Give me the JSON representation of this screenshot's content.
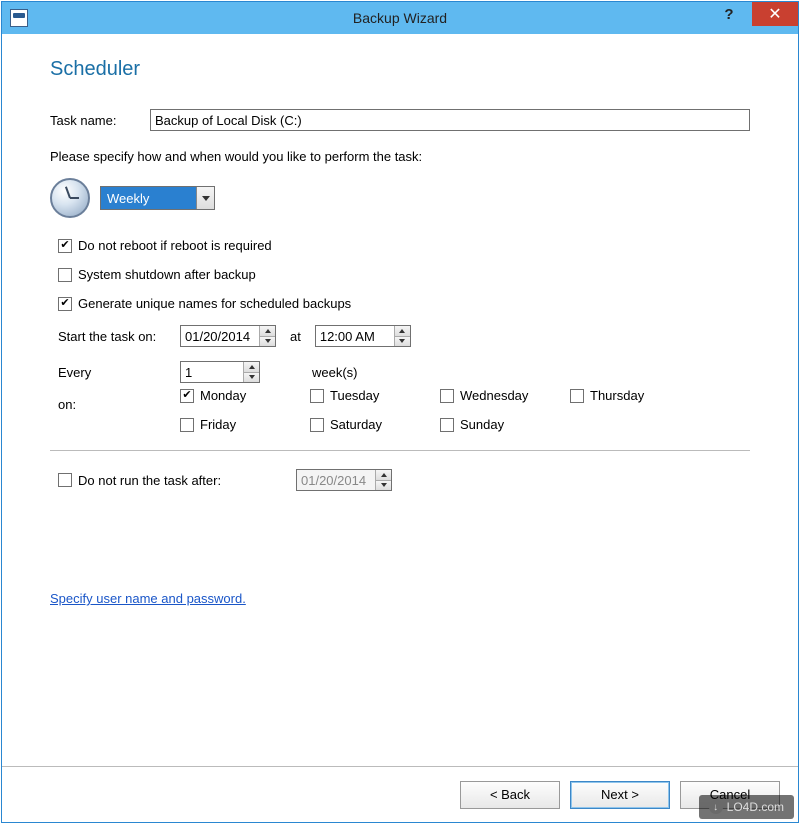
{
  "window": {
    "title": "Backup Wizard",
    "help_symbol": "?",
    "close_symbol": "✕"
  },
  "page": {
    "heading": "Scheduler",
    "task_name_label": "Task name:",
    "task_name_value": "Backup of Local Disk (C:)",
    "instruction": "Please specify how and when would you like to perform the task:",
    "frequency_value": "Weekly",
    "opt_no_reboot": "Do not reboot if reboot is required",
    "opt_shutdown": "System shutdown after backup",
    "opt_unique_names": "Generate unique names for scheduled backups",
    "start_label": "Start the task on:",
    "start_date": "01/20/2014",
    "at_label": "at",
    "start_time": "12:00 AM",
    "every_label": "Every",
    "every_value": "1",
    "weeks_label": "week(s)",
    "on_label": "on:",
    "days": {
      "mon": "Monday",
      "tue": "Tuesday",
      "wed": "Wednesday",
      "thu": "Thursday",
      "fri": "Friday",
      "sat": "Saturday",
      "sun": "Sunday"
    },
    "expire_label": "Do not run the task after:",
    "expire_date": "01/20/2014",
    "credentials_link": "Specify user name and password."
  },
  "footer": {
    "back": "< Back",
    "next": "Next >",
    "cancel": "Cancel"
  },
  "watermark": "LO4D.com"
}
